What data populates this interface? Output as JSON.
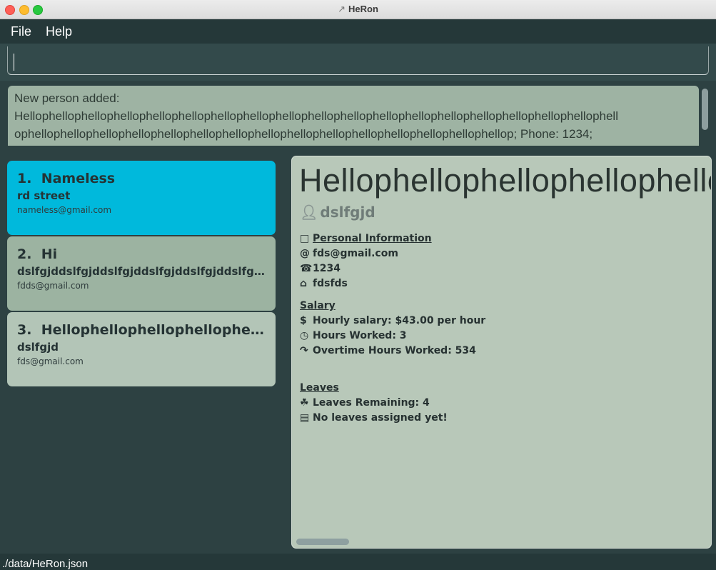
{
  "window": {
    "title": "HeRon",
    "title_icon": "heron-icon"
  },
  "menu": {
    "items": [
      {
        "label": "File"
      },
      {
        "label": "Help"
      }
    ]
  },
  "command": {
    "value": ""
  },
  "result": {
    "lines": [
      "New person added:",
      "Hellophellophellophellophellophellophellophellophellophellophellophellophellophellophellophellophellophellophell",
      "ophellophellophellophellophellophellophellophellophellophellophellophellophellophellophellop; Phone: 1234;"
    ]
  },
  "people": [
    {
      "index": "1.",
      "name": "Nameless",
      "address": "rd street",
      "email": "nameless@gmail.com"
    },
    {
      "index": "2.",
      "name": "Hi",
      "address": "dslfgjddslfgjddslfgjddslfgjddslfgjddslfgjddslfgjd",
      "email": "fdds@gmail.com"
    },
    {
      "index": "3.",
      "name": "Hellophellophellophellophellophellophellophellop",
      "address": "dslfgjd",
      "email": "fds@gmail.com"
    }
  ],
  "detail": {
    "name": "Hellophellophellophellophellophellophellophellop",
    "address": "dslfgjd",
    "personal_header": "Personal Information",
    "email": "fds@gmail.com",
    "phone": "1234",
    "home": "fdsfds",
    "salary_header": "Salary",
    "hourly_salary": "Hourly salary: $43.00 per hour",
    "hours_worked": "Hours Worked: 3",
    "overtime": "Overtime Hours Worked: 534",
    "leaves_header": "Leaves",
    "leaves_remaining": "Leaves Remaining: 4",
    "leaves_assigned": "No leaves assigned yet!"
  },
  "status": {
    "file_path": "./data/HeRon.json"
  },
  "colors": {
    "selected_card": "#00b9dc",
    "card_2": "#9cb3a1",
    "card_3": "#b3c5b7",
    "panel": "#b8c8b9",
    "background": "#2d4142"
  }
}
